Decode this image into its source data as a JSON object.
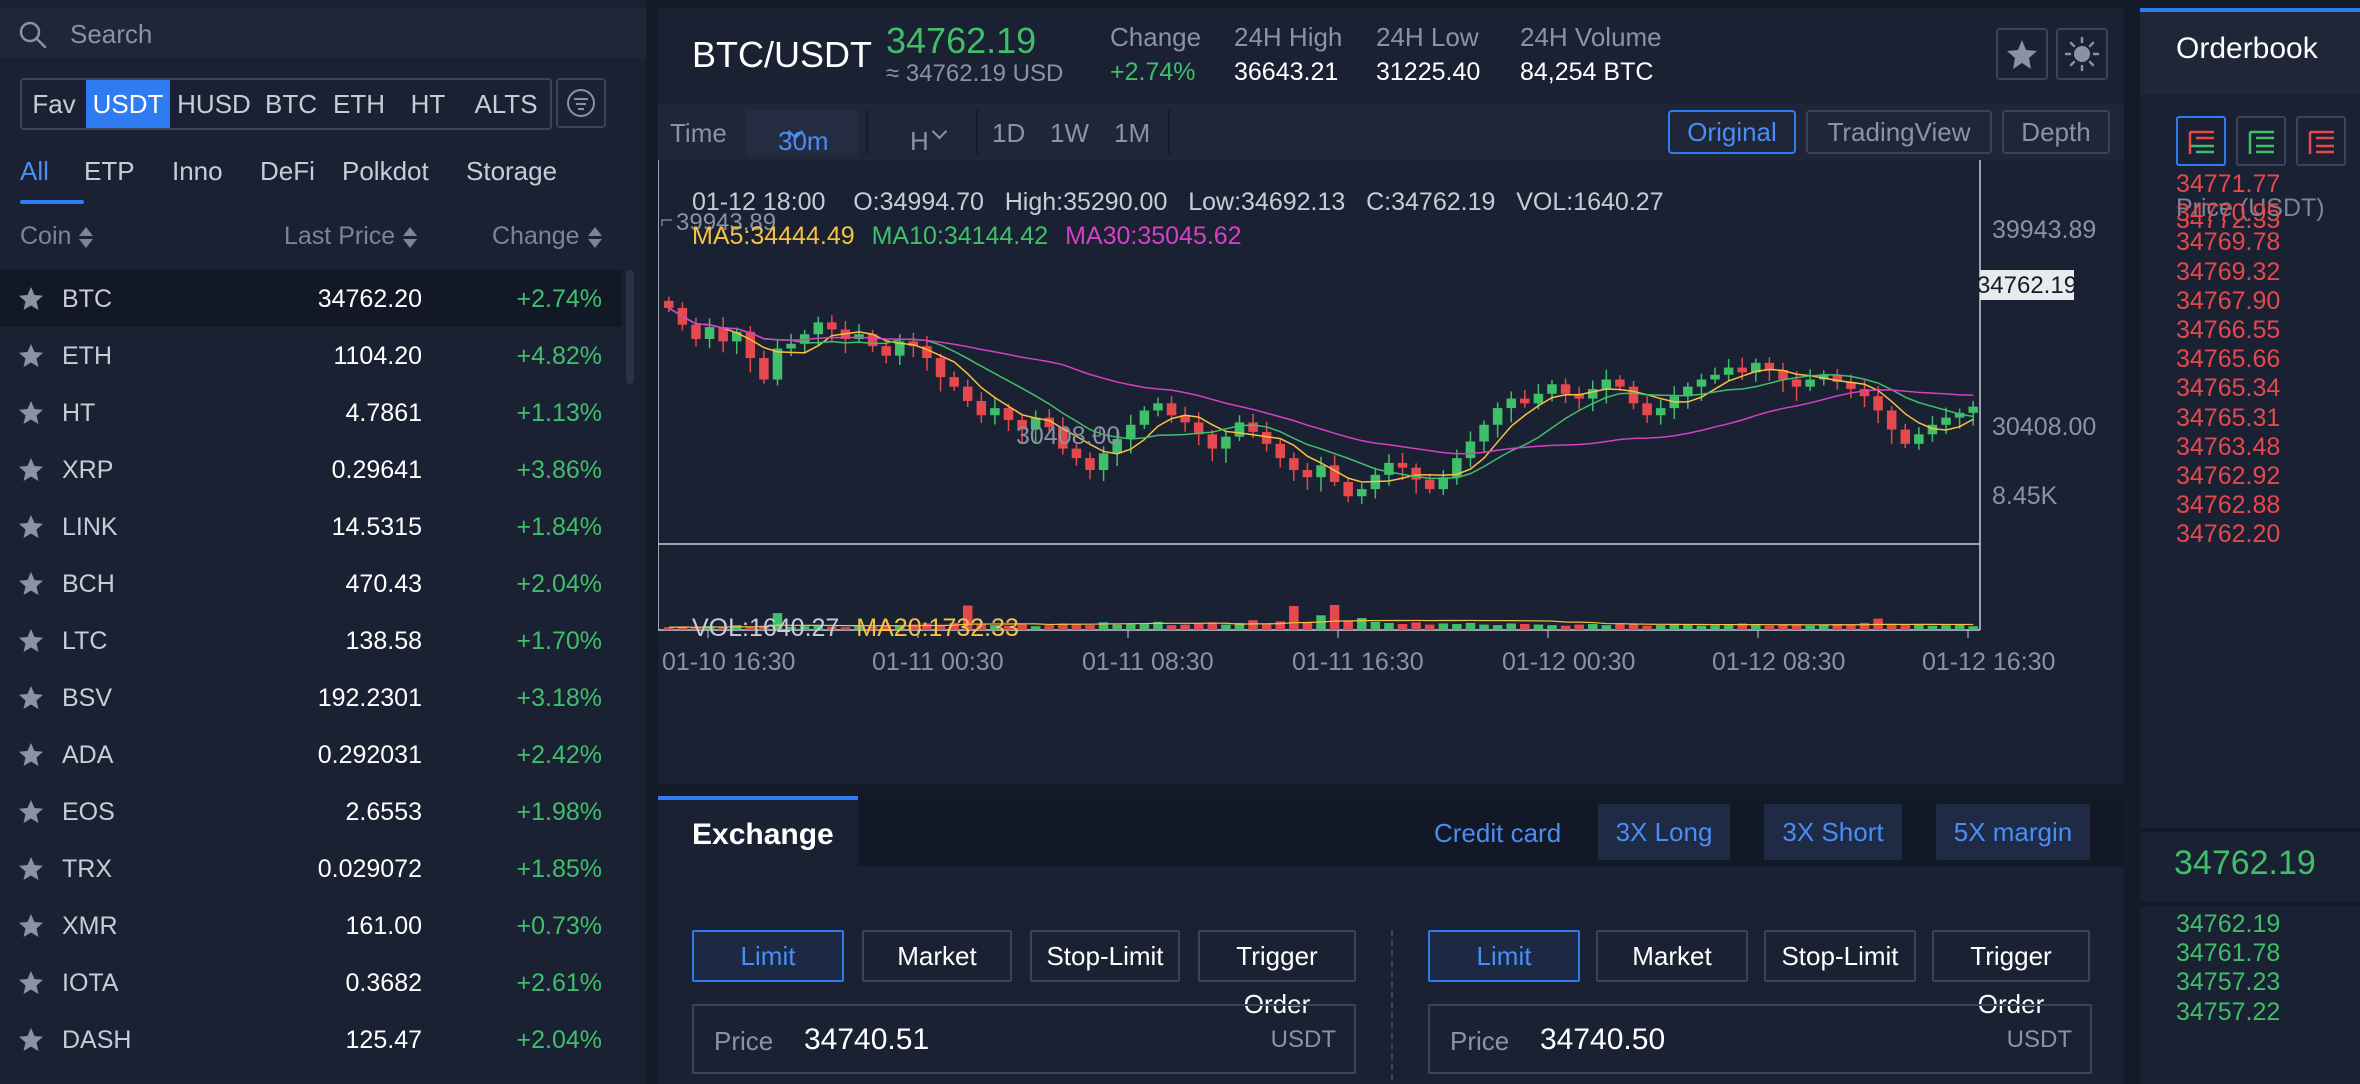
{
  "search": {
    "placeholder": "Search"
  },
  "quote_tabs": [
    "Fav",
    "USDT",
    "HUSD",
    "BTC",
    "ETH",
    "HT",
    "ALTS"
  ],
  "quote_active": "USDT",
  "category_tabs": [
    "All",
    "ETP",
    "Inno",
    "DeFi",
    "Polkdot",
    "Storage"
  ],
  "category_active": "All",
  "list_headers": {
    "coin": "Coin",
    "price": "Last Price",
    "change": "Change"
  },
  "coins": [
    {
      "name": "BTC",
      "price": "34762.20",
      "change": "+2.74%"
    },
    {
      "name": "ETH",
      "price": "1104.20",
      "change": "+4.82%"
    },
    {
      "name": "HT",
      "price": "4.7861",
      "change": "+1.13%"
    },
    {
      "name": "XRP",
      "price": "0.29641",
      "change": "+3.86%"
    },
    {
      "name": "LINK",
      "price": "14.5315",
      "change": "+1.84%"
    },
    {
      "name": "BCH",
      "price": "470.43",
      "change": "+2.04%"
    },
    {
      "name": "LTC",
      "price": "138.58",
      "change": "+1.70%"
    },
    {
      "name": "BSV",
      "price": "192.2301",
      "change": "+3.18%"
    },
    {
      "name": "ADA",
      "price": "0.292031",
      "change": "+2.42%"
    },
    {
      "name": "EOS",
      "price": "2.6553",
      "change": "+1.98%"
    },
    {
      "name": "TRX",
      "price": "0.029072",
      "change": "+1.85%"
    },
    {
      "name": "XMR",
      "price": "161.00",
      "change": "+0.73%"
    },
    {
      "name": "IOTA",
      "price": "0.3682",
      "change": "+2.61%"
    },
    {
      "name": "DASH",
      "price": "125.47",
      "change": "+2.04%"
    }
  ],
  "ticker": {
    "pair": "BTC/USDT",
    "last": "34762.19",
    "approx": "≈ 34762.19 USD",
    "change_label": "Change",
    "change_value": "+2.74%",
    "high_label": "24H High",
    "high_value": "36643.21",
    "low_label": "24H Low",
    "low_value": "31225.40",
    "volume_label": "24H Volume",
    "volume_value": "84,254 BTC"
  },
  "toolbar": {
    "time_label": "Time",
    "interval": "30m",
    "h_label": "H",
    "periods": [
      "1D",
      "1W",
      "1M"
    ],
    "views": [
      "Original",
      "TradingView",
      "Depth"
    ],
    "view_active": "Original"
  },
  "chart_info": {
    "ohlc": "01-12 18:00    O:34994.70   High:35290.00   Low:34692.13   C:34762.19   VOL:1640.27",
    "ma5": "MA5:34444.49",
    "ma10": "MA10:34144.42",
    "ma30": "MA30:35045.62",
    "vol": "VOL:1640.27",
    "vol_ma": "MA20:1732.33"
  },
  "chart_data": {
    "type": "line",
    "price_axis_labels": [
      "39943.89",
      "30408.00"
    ],
    "volume_axis_label": "8.45K",
    "current_price_tag": "34762.19",
    "max_annotation": "39943.89",
    "min_annotation": "30408.00",
    "x_ticks": [
      "01-10 16:30",
      "01-11 00:30",
      "01-11 08:30",
      "01-11 16:30",
      "01-12 00:30",
      "01-12 08:30",
      "01-12 16:30"
    ],
    "price_range": [
      29500,
      41000
    ],
    "close": [
      38900,
      38200,
      37600,
      38100,
      37500,
      37900,
      36800,
      35900,
      37200,
      37400,
      37800,
      38300,
      38000,
      37600,
      37800,
      37300,
      36900,
      37500,
      37300,
      36800,
      36000,
      35600,
      35000,
      34400,
      34700,
      34200,
      33800,
      34300,
      33900,
      33000,
      32600,
      32100,
      32800,
      33400,
      34000,
      34600,
      34900,
      34400,
      34100,
      33600,
      33000,
      33500,
      34100,
      33700,
      33200,
      32600,
      32100,
      31800,
      32300,
      31600,
      31000,
      31300,
      31900,
      32400,
      32200,
      31700,
      31300,
      31800,
      32600,
      33300,
      34000,
      34700,
      35100,
      34900,
      35300,
      35700,
      35300,
      35100,
      35500,
      35900,
      35600,
      34900,
      34400,
      34700,
      35200,
      35600,
      35900,
      36100,
      36400,
      36200,
      36600,
      36300,
      35900,
      35600,
      35900,
      36100,
      35800,
      35500,
      35200,
      34600,
      33800,
      33200,
      33600,
      34000,
      34300,
      34500,
      34762.19
    ],
    "volume": [
      0.5,
      0.6,
      0.4,
      0.7,
      0.5,
      0.9,
      0.5,
      0.8,
      3.1,
      0.6,
      0.7,
      0.9,
      0.6,
      0.5,
      0.7,
      0.6,
      0.8,
      0.7,
      1.0,
      1.2,
      0.9,
      1.3,
      4.5,
      1.0,
      0.9,
      0.8,
      1.1,
      0.7,
      0.9,
      1.2,
      1.1,
      0.9,
      1.4,
      1.0,
      1.2,
      1.1,
      1.5,
      0.9,
      1.0,
      1.2,
      1.4,
      1.0,
      1.3,
      1.8,
      1.2,
      1.6,
      4.4,
      1.4,
      2.7,
      4.6,
      1.6,
      2.2,
      1.5,
      1.3,
      1.1,
      1.4,
      1.0,
      1.2,
      1.1,
      1.3,
      1.0,
      0.9,
      1.2,
      1.1,
      1.0,
      0.9,
      0.8,
      1.0,
      1.1,
      0.9,
      1.2,
      1.0,
      0.8,
      0.9,
      1.0,
      1.1,
      0.8,
      0.9,
      1.0,
      1.2,
      0.9,
      0.8,
      1.0,
      0.9,
      0.8,
      1.0,
      1.1,
      0.9,
      1.3,
      2.1,
      1.1,
      0.9,
      1.0,
      0.8,
      0.9,
      1.0,
      0.7
    ],
    "volume_max": 8.45,
    "ma5_color": "#f5c242",
    "ma10_color": "#3fbf6a",
    "ma30_color": "#d640c6",
    "up_color": "#3fbf6a",
    "down_color": "#e5484d"
  },
  "exchange": {
    "tab": "Exchange",
    "credit_card": "Credit card",
    "promos": [
      "3X Long",
      "3X Short",
      "5X margin"
    ],
    "order_types": [
      "Limit",
      "Market",
      "Stop-Limit",
      "Trigger Order"
    ],
    "buy_price_label": "Price",
    "buy_price_value": "34740.51",
    "sell_price_label": "Price",
    "sell_price_value": "34740.50",
    "unit": "USDT"
  },
  "orderbook": {
    "title": "Orderbook",
    "col_price": "Price (USDT)",
    "partial_ask": "34772.35",
    "asks": [
      "34771.77",
      "34770.95",
      "34769.78",
      "34769.32",
      "34767.90",
      "34766.55",
      "34765.66",
      "34765.34",
      "34765.31",
      "34763.48",
      "34762.92",
      "34762.88",
      "34762.20"
    ],
    "mid": "34762.19",
    "bids": [
      "34762.19",
      "34761.78",
      "34757.23",
      "34757.22"
    ]
  }
}
